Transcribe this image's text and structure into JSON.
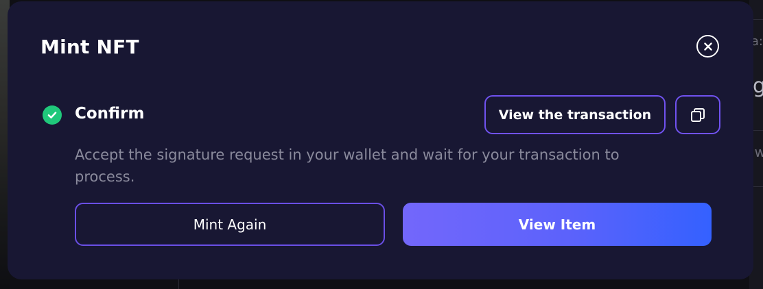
{
  "background": {
    "right_edge_texts": [
      "a:",
      "g",
      "w"
    ]
  },
  "modal": {
    "title": "Mint NFT",
    "close_icon": "close-circle-icon",
    "step": {
      "status_icon": "check-circle-icon",
      "title": "Confirm",
      "description": "Accept the signature request in your wallet and wait for your transaction to process.",
      "view_transaction_label": "View the transaction",
      "copy_icon": "copy-icon"
    },
    "actions": {
      "mint_again_label": "Mint Again",
      "view_item_label": "View Item"
    }
  },
  "colors": {
    "modal_bg": "#181733",
    "accent_border": "#7052f0",
    "success": "#20c87b",
    "muted_text": "#8a8a9c",
    "gradient_start": "#7367fb",
    "gradient_end": "#3461ff"
  }
}
